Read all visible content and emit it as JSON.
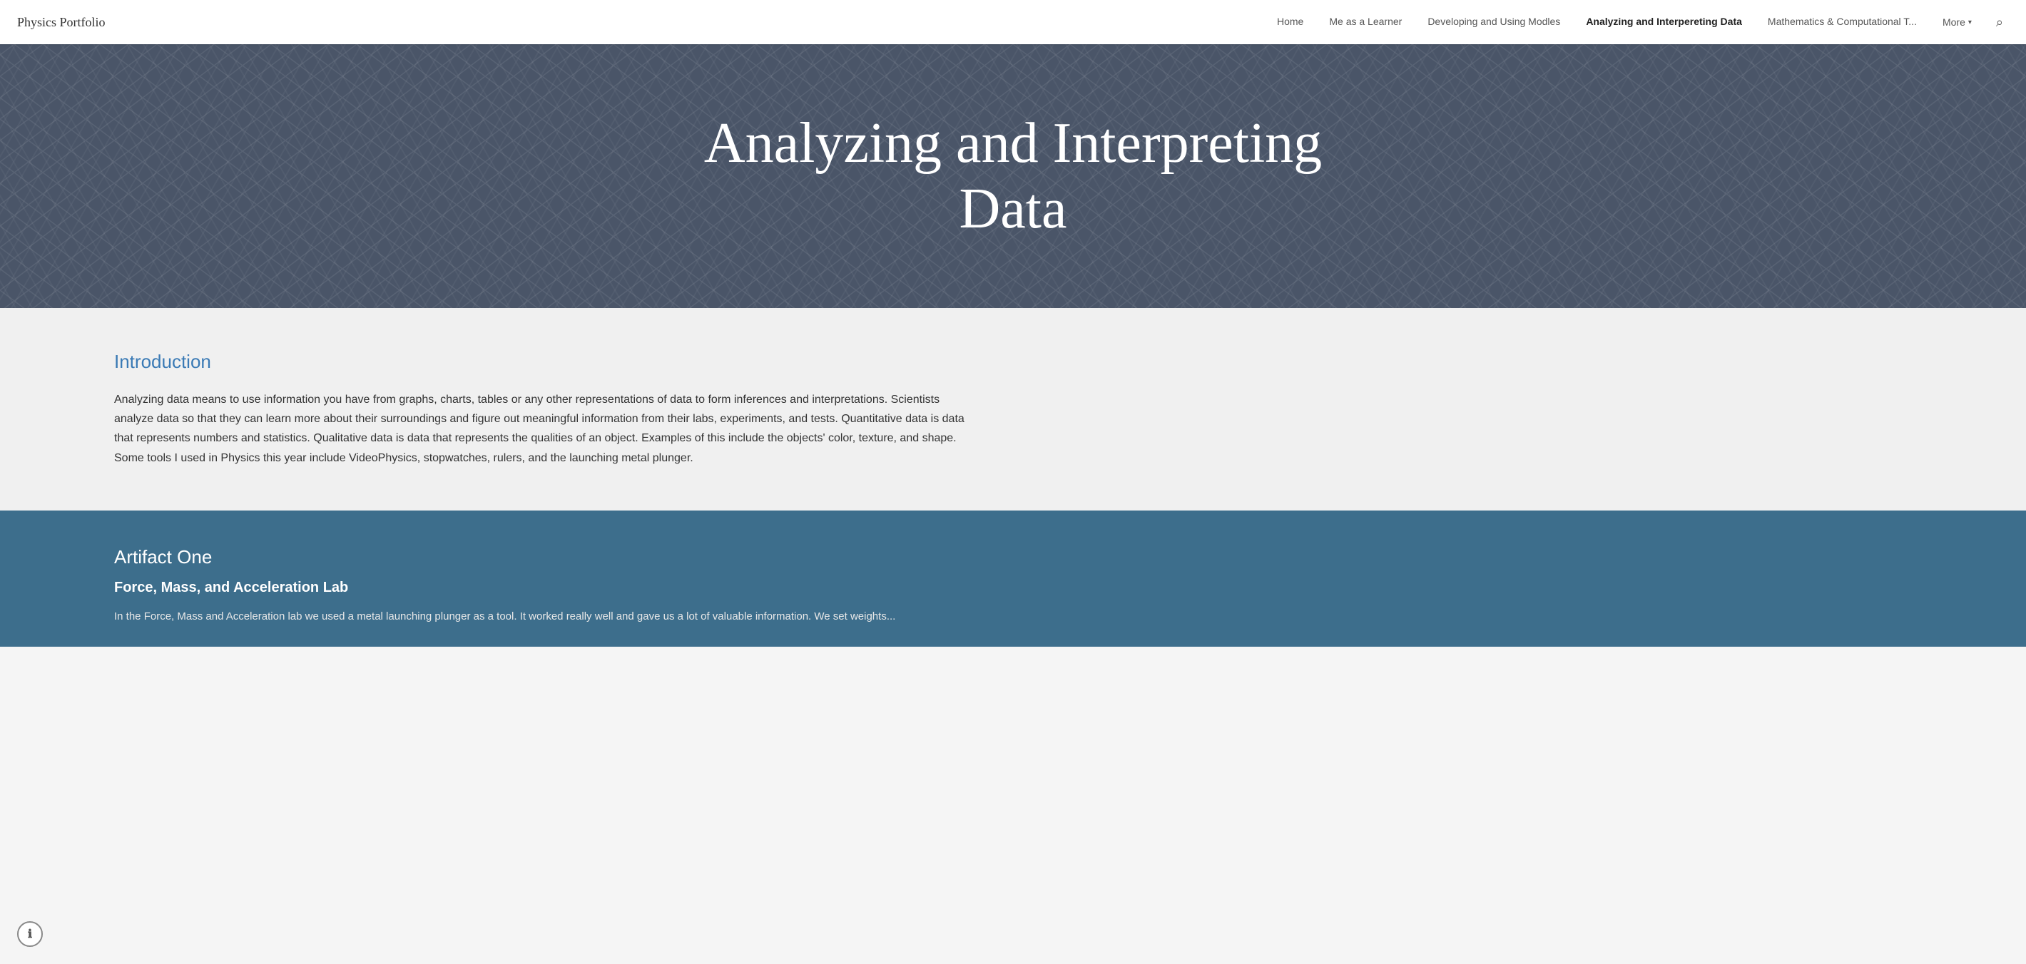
{
  "brand": "Physics Portfolio",
  "nav": {
    "links": [
      {
        "label": "Home",
        "active": false
      },
      {
        "label": "Me as a Learner",
        "active": false
      },
      {
        "label": "Developing and Using Modles",
        "active": false
      },
      {
        "label": "Analyzing and Interpereting Data",
        "active": true
      },
      {
        "label": "Mathematics & Computational T...",
        "active": false
      }
    ],
    "more_label": "More",
    "search_symbol": "🔍"
  },
  "hero": {
    "title": "Analyzing and Interpreting Data"
  },
  "intro": {
    "heading": "Introduction",
    "body": "Analyzing data means to use information you have from graphs, charts, tables or any other representations of data to form inferences and interpretations. Scientists analyze data so that they can learn more about their surroundings and figure out meaningful information from their labs, experiments, and tests. Quantitative data is data that represents numbers and statistics. Qualitative data is data that represents the qualities of an object. Examples of this include the objects' color, texture, and shape. Some tools I used in Physics this year include VideoPhysics, stopwatches, rulers, and the launching metal plunger."
  },
  "artifact": {
    "heading": "Artifact One",
    "subheading": "Force, Mass, and Acceleration Lab",
    "body": "In the Force, Mass and Acceleration lab we used a metal launching plunger as a tool. It worked really well and gave us a lot of valuable information. We set weights..."
  }
}
